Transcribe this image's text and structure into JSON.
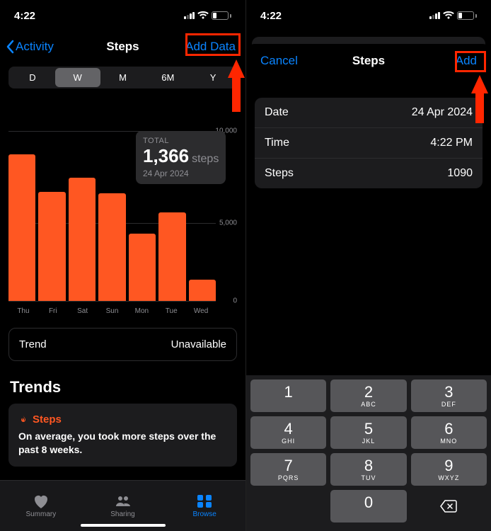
{
  "status": {
    "time": "4:22",
    "battery": "27"
  },
  "left": {
    "nav": {
      "back": "Activity",
      "title": "Steps",
      "action": "Add Data"
    },
    "segments": [
      "D",
      "W",
      "M",
      "6M",
      "Y"
    ],
    "summary": {
      "label": "TOTAL",
      "value": "1,366",
      "unit": "steps",
      "date": "24 Apr 2024"
    },
    "axis_labels": {
      "top": "10,000",
      "mid": "5,000",
      "bottom": "0"
    },
    "trend_row": {
      "label": "Trend",
      "value": "Unavailable"
    },
    "section_title": "Trends",
    "trend_card": {
      "title": "Steps",
      "text": "On average, you took more steps over the past 8 weeks."
    },
    "tabs": {
      "summary": "Summary",
      "sharing": "Sharing",
      "browse": "Browse"
    }
  },
  "right": {
    "nav": {
      "cancel": "Cancel",
      "title": "Steps",
      "add": "Add"
    },
    "form": {
      "date_label": "Date",
      "date_value": "24 Apr 2024",
      "time_label": "Time",
      "time_value": "4:22 PM",
      "steps_label": "Steps",
      "steps_value": "1090"
    },
    "keys": [
      [
        "1",
        ""
      ],
      [
        "2",
        "ABC"
      ],
      [
        "3",
        "DEF"
      ],
      [
        "4",
        "GHI"
      ],
      [
        "5",
        "JKL"
      ],
      [
        "6",
        "MNO"
      ],
      [
        "7",
        "PQRS"
      ],
      [
        "8",
        "TUV"
      ],
      [
        "9",
        "WXYZ"
      ],
      [
        "",
        "blank"
      ],
      [
        "0",
        ""
      ],
      [
        "",
        "del"
      ]
    ]
  },
  "chart_data": {
    "type": "bar",
    "categories": [
      "Thu",
      "Fri",
      "Sat",
      "Sun",
      "Mon",
      "Tue",
      "Wed"
    ],
    "values": [
      9400,
      7000,
      7900,
      6900,
      4300,
      5700,
      1366
    ],
    "ylim": [
      0,
      10000
    ],
    "title": "Steps",
    "xlabel": "",
    "ylabel": "steps"
  }
}
